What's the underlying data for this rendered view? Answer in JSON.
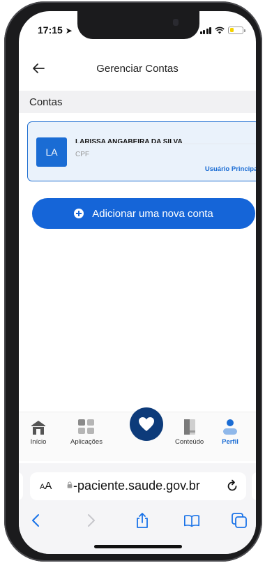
{
  "status_bar": {
    "time": "17:15",
    "battery_level": 0.3
  },
  "header": {
    "title": "Gerenciar Contas"
  },
  "section": {
    "title": "Contas"
  },
  "account": {
    "initials": "LA",
    "name": "LARISSA ANGABEIRA DA SILVA",
    "cpf_label": "CPF",
    "role": "Usuário Principal"
  },
  "add_account": {
    "label": "Adicionar uma nova conta"
  },
  "tab_bar": {
    "items": [
      {
        "label": "Início",
        "icon": "home-icon"
      },
      {
        "label": "Aplicações",
        "icon": "apps-grid-icon"
      },
      {
        "label": "",
        "icon": "heart-icon"
      },
      {
        "label": "Conteúdo",
        "icon": "book-icon"
      },
      {
        "label": "Perfil",
        "icon": "user-icon"
      }
    ],
    "active": "Perfil"
  },
  "browser": {
    "text_size_label": "AA",
    "url": "-paciente.saude.gov.br"
  },
  "colors": {
    "primary": "#1565d8",
    "fab": "#0d3b7a",
    "card_bg": "#eaf2fb"
  }
}
